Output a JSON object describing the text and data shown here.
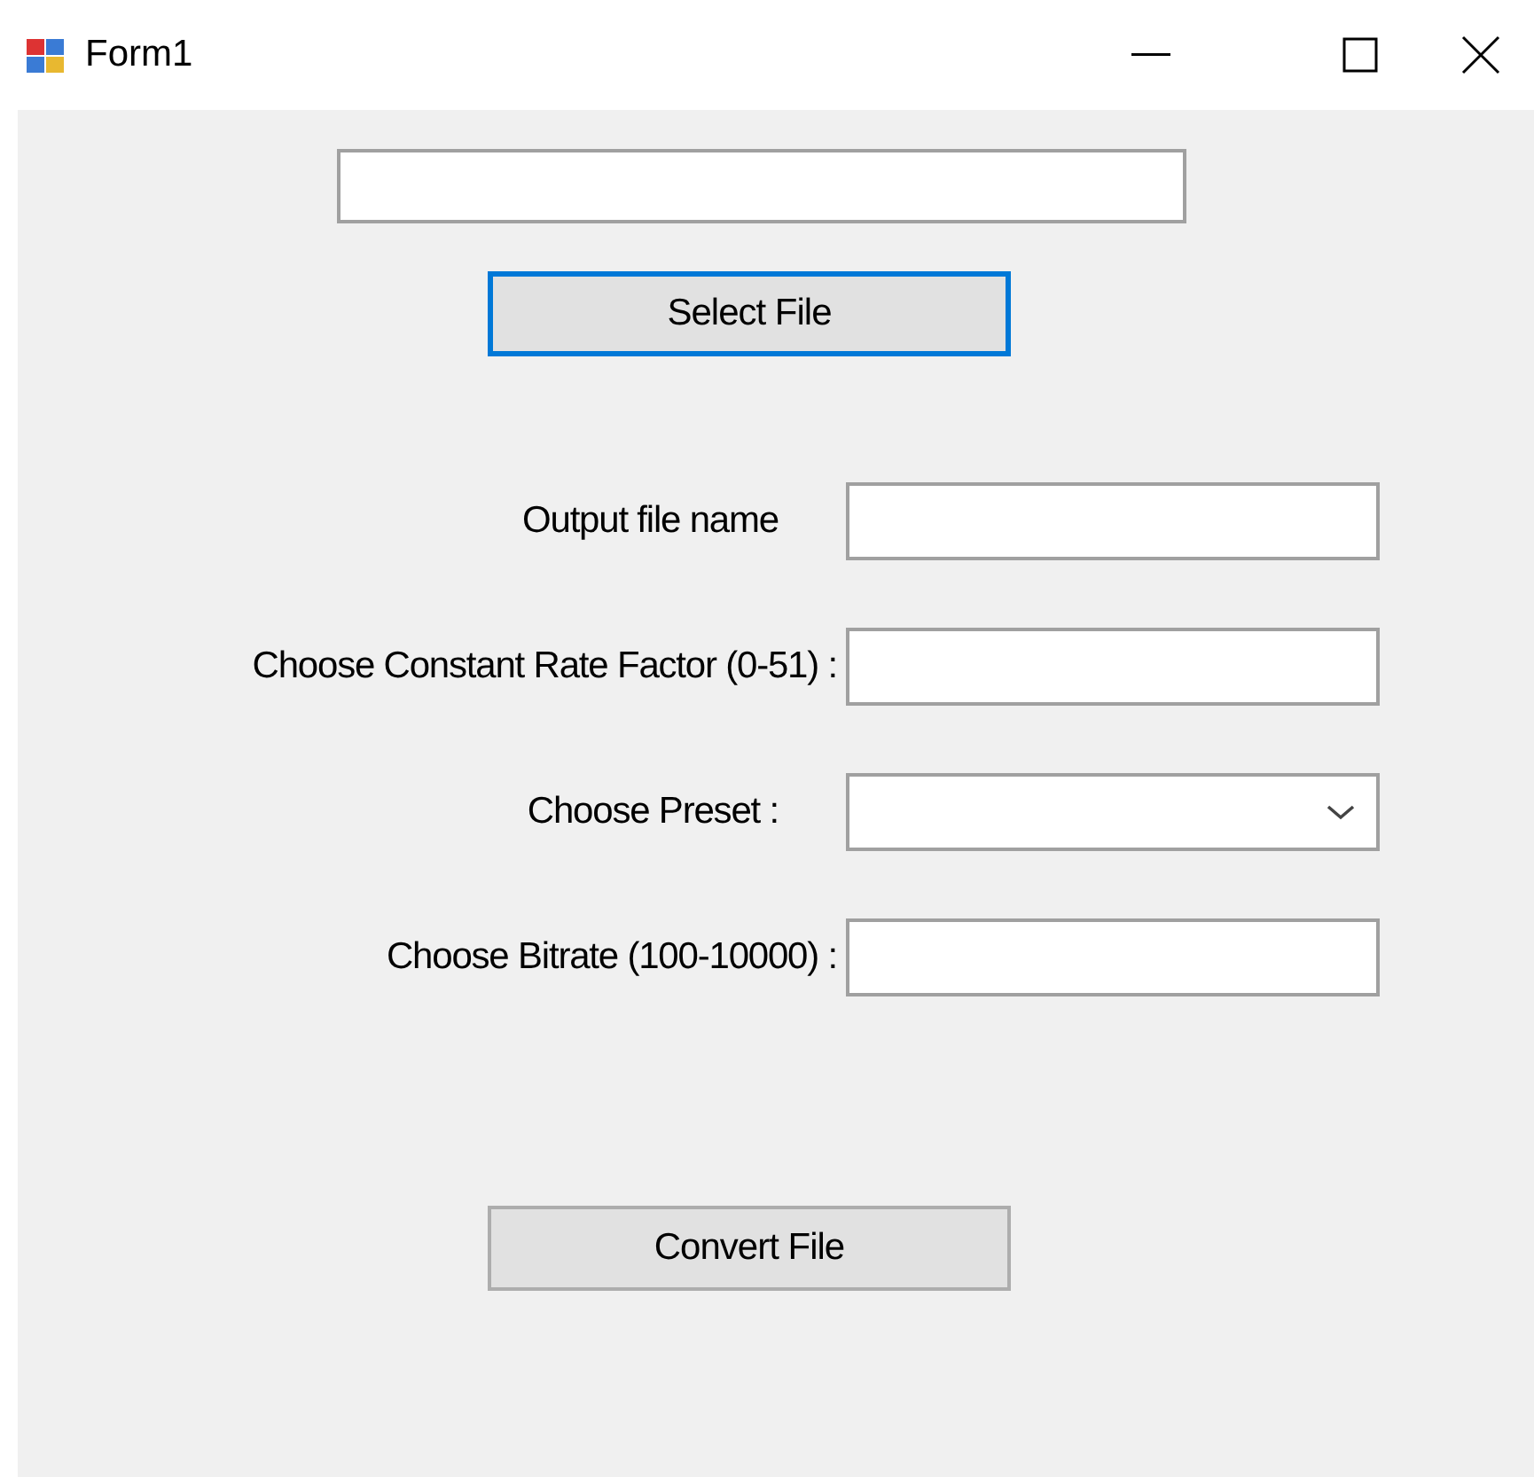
{
  "window": {
    "title": "Form1"
  },
  "select_button": {
    "label": "Select File",
    "focused": true
  },
  "fields": [
    {
      "label": "Output file name",
      "kind": "text"
    },
    {
      "label": "Choose Constant Rate Factor (0-51) :",
      "kind": "text"
    },
    {
      "label": "Choose Preset :",
      "kind": "dropdown"
    },
    {
      "label": "Choose Bitrate (100-10000) :",
      "kind": "text"
    }
  ],
  "convert_button": {
    "label": "Convert File",
    "focused": false
  }
}
